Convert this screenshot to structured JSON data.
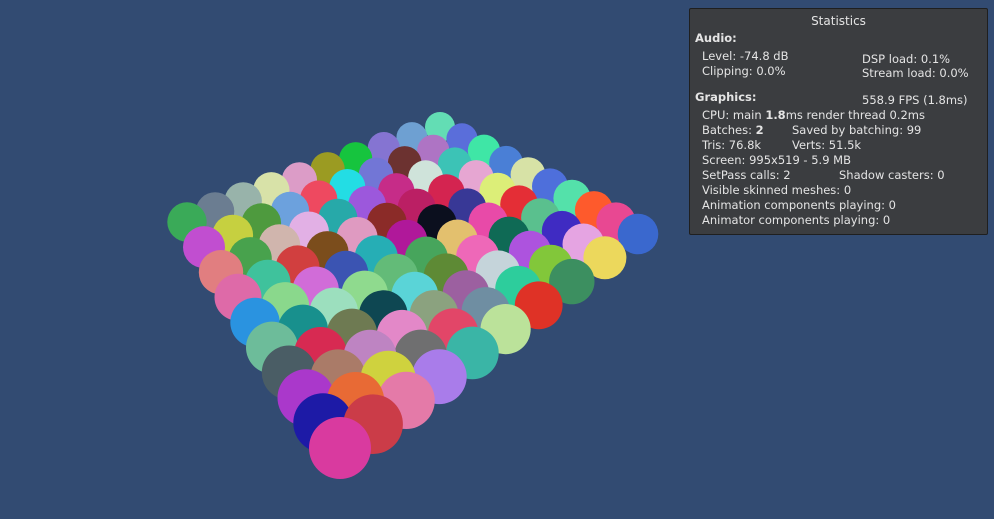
{
  "scene": {
    "background": "#324b72",
    "sphere_colors": [
      "#63ddb4",
      "#5a6eda",
      "#3fe6a6",
      "#4a7fd6",
      "#d7e2a6",
      "#4e6fdb",
      "#54e1aa",
      "#fe5a2c",
      "#e84892",
      "#3a68ce",
      "#6ea0d2",
      "#ae74c4",
      "#3cc3b6",
      "#e6a6d2",
      "#dcee78",
      "#e42e36",
      "#5ac08e",
      "#3f2bc2",
      "#e5a4e2",
      "#ecd85c",
      "#8574d2",
      "#6c3230",
      "#cfe3da",
      "#d42450",
      "#383896",
      "#e84aa8",
      "#0f6a55",
      "#ad53de",
      "#82c73a",
      "#3c8f60",
      "#16c43e",
      "#7276d6",
      "#c62c88",
      "#bb1f64",
      "#0b0f1e",
      "#e3c06e",
      "#ee68b8",
      "#c5d4da",
      "#2dcd9c",
      "#df3226",
      "#9b9b22",
      "#23dde4",
      "#9c58dc",
      "#8b2b28",
      "#b0189a",
      "#47a55c",
      "#5e8a35",
      "#9c60a0",
      "#6f8ea2",
      "#bbe29a",
      "#dc9cc7",
      "#ee4960",
      "#27a9a9",
      "#df9ac1",
      "#26aeb5",
      "#63bb78",
      "#5ad4d7",
      "#8ba27f",
      "#e24668",
      "#3ab5a6",
      "#d8e2a8",
      "#6ca1dd",
      "#e2b0e5",
      "#7b4d1c",
      "#3b54b2",
      "#8fda8e",
      "#0e4752",
      "#e388c8",
      "#6f6f70",
      "#a97cea",
      "#98b3aa",
      "#4e9a3e",
      "#d0b5ad",
      "#d13f3f",
      "#d16cd8",
      "#9cdfbe",
      "#6e7a52",
      "#be84c2",
      "#cfd23e",
      "#e47aa8",
      "#6b7d91",
      "#c6d040",
      "#48a24d",
      "#3fc29c",
      "#8ad88c",
      "#18908d",
      "#d72a52",
      "#aa7b68",
      "#e86a35",
      "#cb3c48",
      "#3aaa58",
      "#c14ed0",
      "#e17e80",
      "#de6aa8",
      "#2a93e0",
      "#6dbc9a",
      "#4a5d65",
      "#aa38cb",
      "#1d1aa6",
      "#d93a9f"
    ]
  },
  "statistics": {
    "title": "Statistics",
    "audio": {
      "header": "Audio:",
      "level": "Level: -74.8 dB",
      "clipping": "Clipping: 0.0%",
      "dsp_load": "DSP load: 0.1%",
      "stream_load": "Stream load: 0.0%"
    },
    "graphics": {
      "header": "Graphics:",
      "fps": "558.9 FPS (1.8ms)",
      "cpu_prefix": "CPU: main ",
      "cpu_main": "1.8",
      "cpu_suffix": "ms  render thread 0.2ms",
      "batches_prefix": "Batches: ",
      "batches": "2",
      "saved_by_batching": "Saved by batching: 99",
      "tris": "Tris: 76.8k",
      "verts": "Verts: 51.5k",
      "screen": "Screen: 995x519 - 5.9 MB",
      "setpass": "SetPass calls: 2",
      "shadow_casters": "Shadow casters: 0",
      "visible_skinned": "Visible skinned meshes: 0",
      "animation_components": "Animation components playing: 0",
      "animator_components": "Animator components playing: 0"
    }
  }
}
